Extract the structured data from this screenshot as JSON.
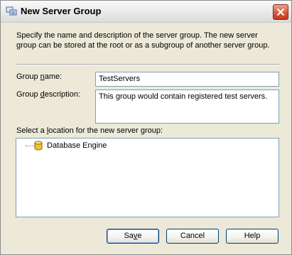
{
  "window": {
    "title": "New Server Group"
  },
  "description": "Specify the name and description of the server group. The new server group can be stored at the root or as a subgroup of another server group.",
  "group_name": {
    "label_prefix": "Group ",
    "label_key": "n",
    "label_suffix": "ame:",
    "value": "TestServers"
  },
  "group_description": {
    "label_prefix": "Group ",
    "label_key": "d",
    "label_suffix": "escription:",
    "value": "This group would contain registered test servers."
  },
  "location": {
    "label_prefix": "Select a ",
    "label_key": "l",
    "label_suffix": "ocation for the new server group:",
    "tree_items": [
      {
        "label": "Database Engine",
        "icon": "database-cylinder-icon"
      }
    ]
  },
  "buttons": {
    "save_prefix": "Sa",
    "save_key": "v",
    "save_suffix": "e",
    "cancel": "Cancel",
    "help": "Help"
  },
  "colors": {
    "accent_border": "#7f9db9",
    "close_red": "#d9583b",
    "db_yellow": "#f2c12e"
  }
}
